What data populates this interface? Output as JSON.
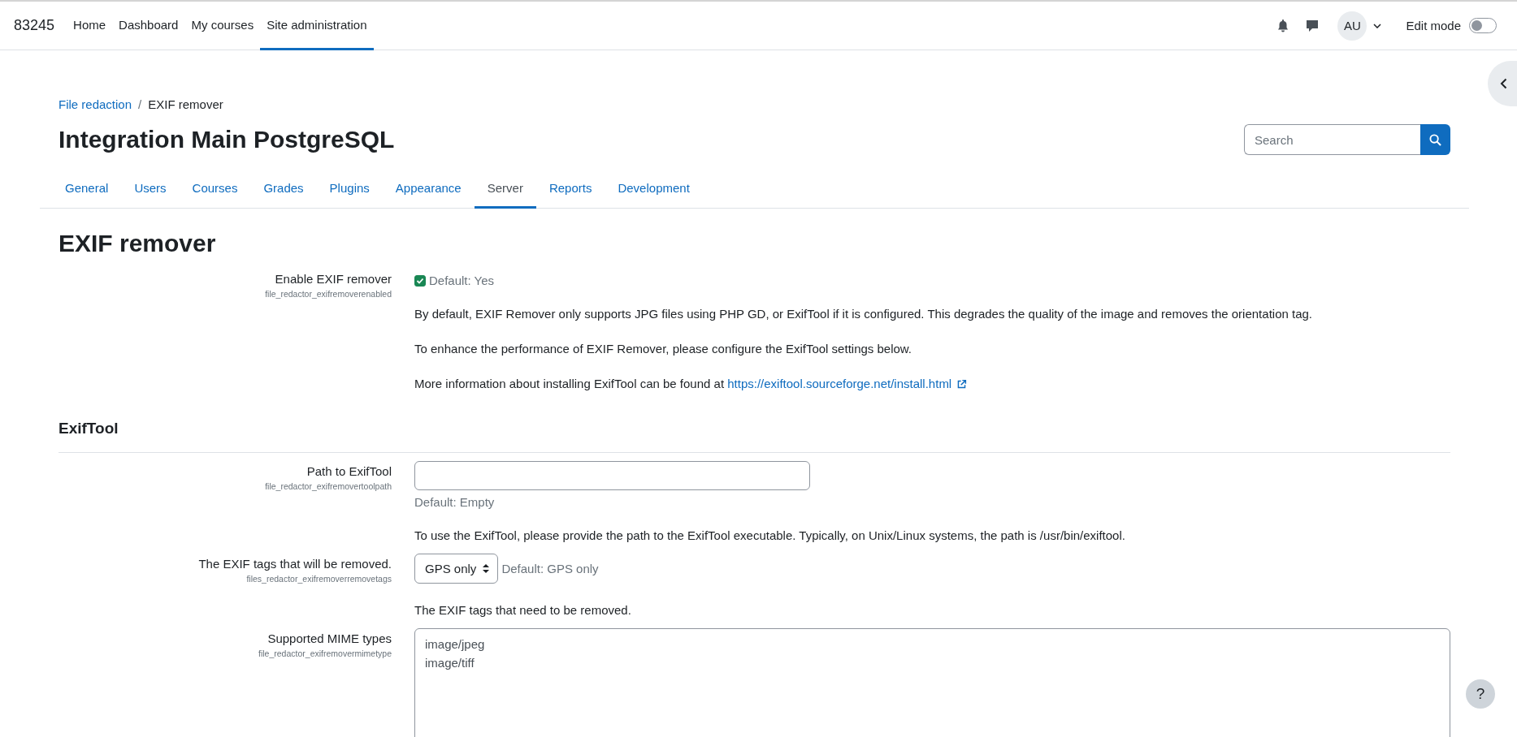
{
  "navbar": {
    "brand": "83245",
    "items": [
      {
        "label": "Home",
        "selected": false
      },
      {
        "label": "Dashboard",
        "selected": false
      },
      {
        "label": "My courses",
        "selected": false
      },
      {
        "label": "Site administration",
        "selected": true
      }
    ],
    "avatar": "AU",
    "edit_mode": {
      "label": "Edit mode",
      "on": false
    }
  },
  "breadcrumb": {
    "items": [
      {
        "label": "File redaction",
        "kind": "link"
      },
      {
        "label": "EXIF remover",
        "kind": "current"
      }
    ],
    "separator": "/"
  },
  "page_title": "Integration Main PostgreSQL",
  "search": {
    "placeholder": "Search"
  },
  "tabs": [
    {
      "label": "General",
      "selected": false
    },
    {
      "label": "Users",
      "selected": false
    },
    {
      "label": "Courses",
      "selected": false
    },
    {
      "label": "Grades",
      "selected": false
    },
    {
      "label": "Plugins",
      "selected": false
    },
    {
      "label": "Appearance",
      "selected": false
    },
    {
      "label": "Server",
      "selected": true
    },
    {
      "label": "Reports",
      "selected": false
    },
    {
      "label": "Development",
      "selected": false
    }
  ],
  "section_title": "EXIF remover",
  "settings": [
    {
      "kind": "checkbox",
      "label": "Enable EXIF remover",
      "key": "file_redactor_exifremoverenabled",
      "checked": true,
      "default": "Default: Yes",
      "descriptions": [
        {
          "text": "By default, EXIF Remover only supports JPG files using PHP GD, or ExifTool if it is configured. This degrades the quality of the image and removes the orientation tag."
        },
        {
          "text": "To enhance the performance of EXIF Remover, please configure the ExifTool settings below."
        },
        {
          "text": "More information about installing ExifTool can be found at",
          "link": "https://exiftool.sourceforge.net/install.html"
        }
      ]
    },
    {
      "kind": "heading",
      "label": "ExifTool"
    },
    {
      "kind": "text",
      "label": "Path to ExifTool",
      "key": "file_redactor_exifremovertoolpath",
      "default": "Default: Empty",
      "descriptions": [
        {
          "text": "To use the ExifTool, please provide the path to the ExifTool executable. Typically, on Unix/Linux systems, the path is /usr/bin/exiftool."
        }
      ]
    },
    {
      "kind": "select",
      "label": "The EXIF tags that will be removed.",
      "key": "files_redactor_exifremoverremovetags",
      "value": "GPS only",
      "default": "Default: GPS only",
      "descriptions": [
        {
          "text": "The EXIF tags that need to be removed."
        }
      ]
    },
    {
      "kind": "textarea",
      "label": "Supported MIME types",
      "key": "file_redactor_exifremovermimetype",
      "lines": [
        "image/jpeg",
        "image/tiff"
      ]
    }
  ],
  "help_button": "?"
}
